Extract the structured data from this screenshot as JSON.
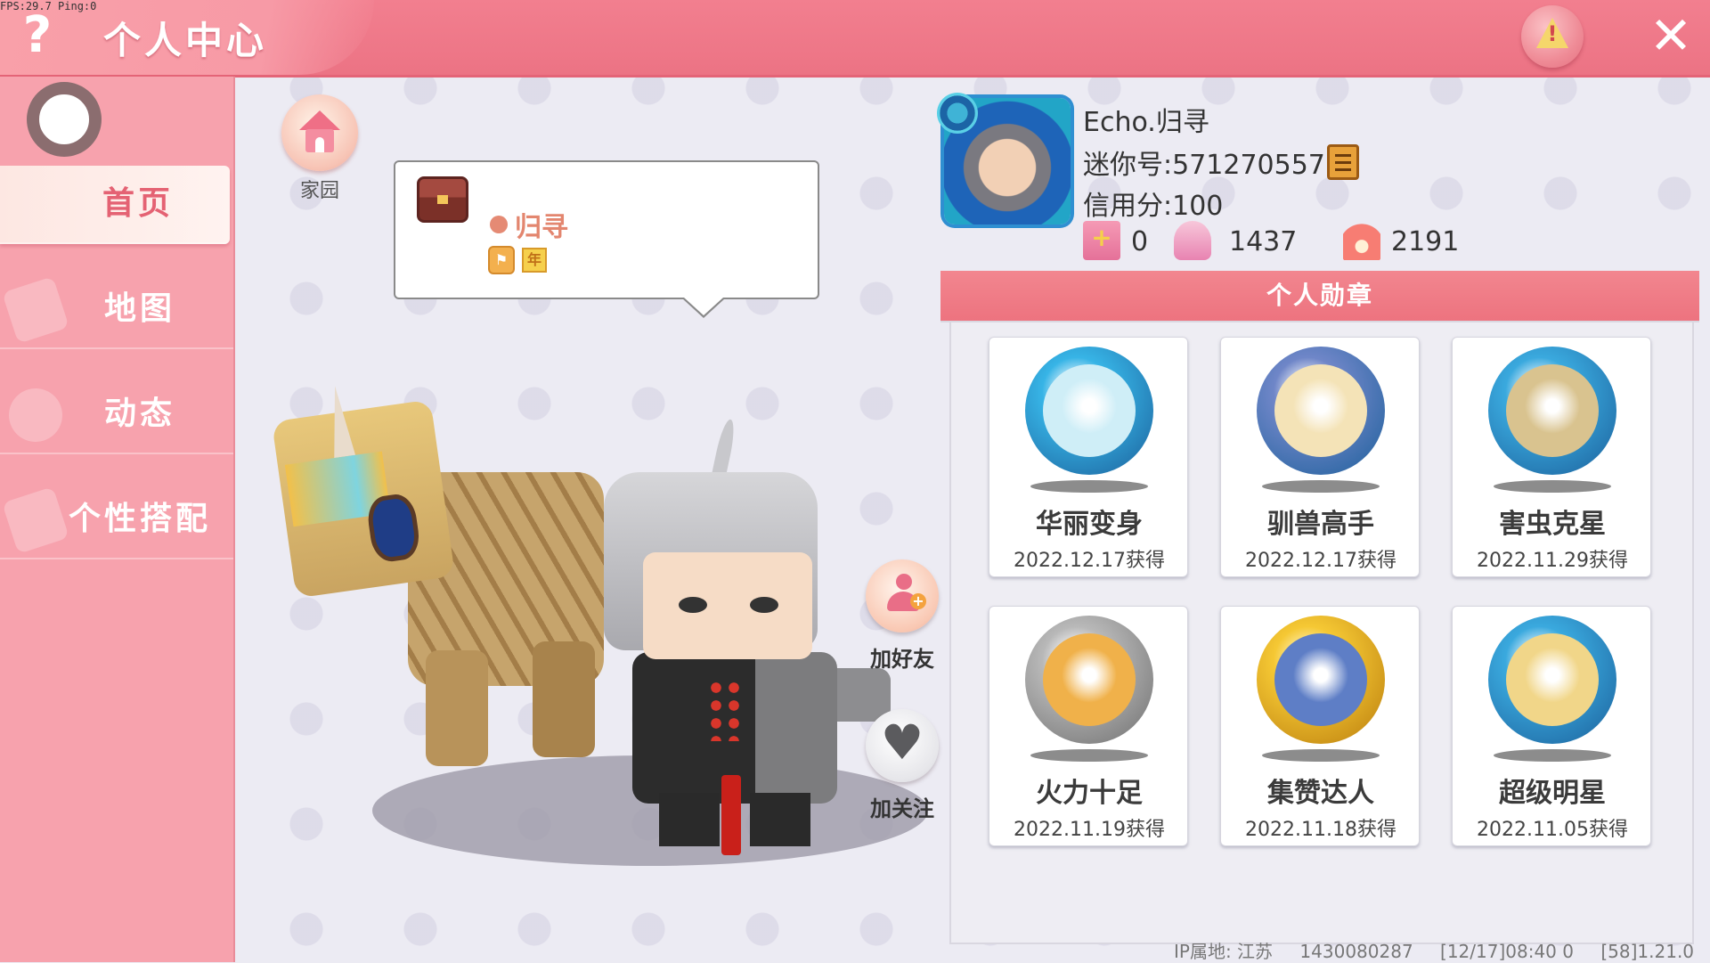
{
  "debug": {
    "fps_text": "FPS:29.7  Ping:0"
  },
  "topbar": {
    "help_glyph": "?",
    "title": "个人中心",
    "warn_glyph": "!",
    "close_glyph": "✕",
    "icons": {
      "help": "help-icon",
      "warn": "warning-icon",
      "close": "close-icon"
    }
  },
  "sidebar": {
    "items": [
      {
        "label": "首页",
        "active": true
      },
      {
        "label": "地图",
        "active": false
      },
      {
        "label": "动态",
        "active": false
      },
      {
        "label": "个性搭配",
        "active": false
      }
    ]
  },
  "home": {
    "label": "家园"
  },
  "bubble": {
    "name": "归寻",
    "badge_a": "⚑",
    "badge_b": "年"
  },
  "actions": {
    "add_friend_label": "加好友",
    "follow_label": "加关注",
    "follow_glyph": "♥"
  },
  "profile": {
    "username": "Echo.归寻",
    "mini_id": "迷你号:571270557",
    "credit": "信用分:100",
    "stats": [
      {
        "icon": "bookmark-plus-icon",
        "value": "0"
      },
      {
        "icon": "trophy-icon",
        "value": "1437"
      },
      {
        "icon": "flame-icon",
        "value": "2191"
      }
    ]
  },
  "badges": {
    "title": "个人勋章",
    "items": [
      {
        "name": "华丽变身",
        "date": "2022.12.17获得",
        "icon": "dinosaur-medal-icon",
        "ring": "#37b4e6",
        "core": "#cfeef7"
      },
      {
        "name": "驯兽高手",
        "date": "2022.12.17获得",
        "icon": "horse-rider-medal-icon",
        "ring": "#6f86c8",
        "core": "#f4e3b7"
      },
      {
        "name": "害虫克星",
        "date": "2022.11.29获得",
        "icon": "bug-medal-icon",
        "ring": "#3aa9de",
        "core": "#d9c38f"
      },
      {
        "name": "火力十足",
        "date": "2022.11.19获得",
        "icon": "weapon-chest-medal-icon",
        "ring": "#9a9a9a",
        "core": "#f0b14a"
      },
      {
        "name": "集赞达人",
        "date": "2022.11.18获得",
        "icon": "thumbs-up-medal-icon",
        "ring": "#e7b21f",
        "core": "#5e7ec6"
      },
      {
        "name": "超级明星",
        "date": "2022.11.05获得",
        "icon": "star-medal-icon",
        "ring": "#3aa9de",
        "core": "#f1d689"
      }
    ]
  },
  "footer": {
    "ip": "IP属地: 江苏",
    "uid": "1430080287",
    "time": "[12/17]08:40 0",
    "version": "[58]1.21.0"
  }
}
